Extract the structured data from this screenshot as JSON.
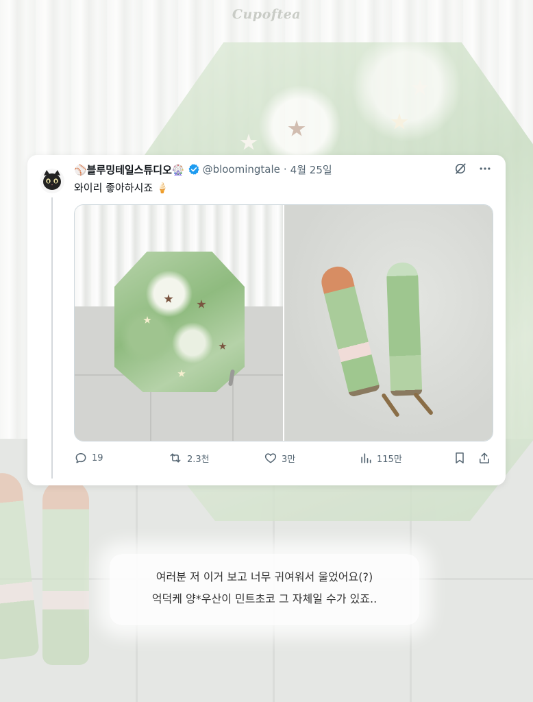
{
  "brand": "Cupoftea",
  "tweet": {
    "display_name": "⚾블루밍테일스튜디오🎡",
    "handle": "@bloomingtale",
    "separator": "·",
    "date": "4월 25일",
    "text": "와이리 좋아하시죠 🍦",
    "avatar_icon": "black-cat-avatar",
    "stats": {
      "replies": "19",
      "retweets": "2.3천",
      "likes": "3만",
      "views": "115만"
    },
    "colors": {
      "verified": "#1d9bf0",
      "text": "#0f1419",
      "muted": "#536471"
    }
  },
  "caption": {
    "line1": "여러분 저 이거 보고 너무 귀여워서 울었어요(?)",
    "line2": "억덕케 양*우산이 민트초코 그 자체일 수가 있죠.."
  }
}
